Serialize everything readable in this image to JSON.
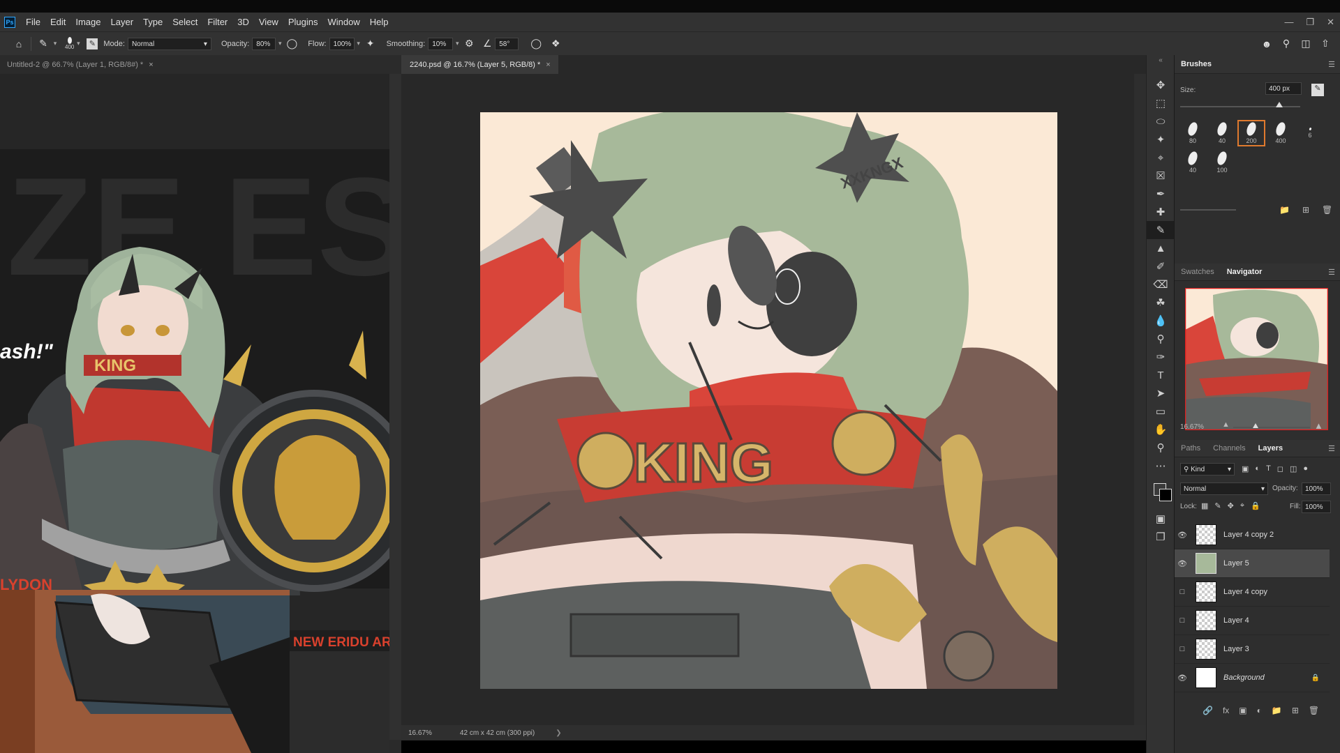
{
  "app": {
    "logo_text": "Ps",
    "menu": [
      "File",
      "Edit",
      "Image",
      "Layer",
      "Type",
      "Select",
      "Filter",
      "3D",
      "View",
      "Plugins",
      "Window",
      "Help"
    ],
    "window_controls": [
      "minimize",
      "restore",
      "close"
    ]
  },
  "options_bar": {
    "brush_size_value": "400",
    "mode_label": "Mode:",
    "mode_value": "Normal",
    "opacity_label": "Opacity:",
    "opacity_value": "80%",
    "flow_label": "Flow:",
    "flow_value": "100%",
    "smoothing_label": "Smoothing:",
    "smoothing_value": "10%",
    "angle_value": "58°"
  },
  "tabs": {
    "left": "Untitled-2 @ 66.7% (Layer 1, RGB/8#) *",
    "active": "2240.psd @ 16.7% (Layer 5, RGB/8) *"
  },
  "status": {
    "zoom": "16.67%",
    "doc_size": "42 cm x 42 cm (300 ppi)"
  },
  "reference_image": {
    "caption_left": "ash!\"",
    "caption_bottom_left": "LYDON",
    "caption_bottom_right": "NEW ERIDU AR",
    "belt_text": "KING"
  },
  "artwork": {
    "banner_text": "KING",
    "hair_text": "XXKNGX"
  },
  "brushes_panel": {
    "title": "Brushes",
    "size_label": "Size:",
    "size_value": "400 px",
    "presets": [
      "80",
      "40",
      "200",
      "400",
      "6",
      "40",
      "100"
    ],
    "selected_preset": "200"
  },
  "navigator_panel": {
    "tabs": [
      "Swatches",
      "Navigator"
    ],
    "active_tab": "Navigator",
    "zoom": "16.67%"
  },
  "layers_panel": {
    "tabs": [
      "Paths",
      "Channels",
      "Layers"
    ],
    "active_tab": "Layers",
    "filter_kind": "Kind",
    "blend_mode": "Normal",
    "opacity_label": "Opacity:",
    "opacity_value": "100%",
    "lock_label": "Lock:",
    "fill_label": "Fill:",
    "fill_value": "100%",
    "layers": [
      {
        "name": "Layer 4 copy 2",
        "visible": true
      },
      {
        "name": "Layer 5",
        "visible": true,
        "selected": true
      },
      {
        "name": "Layer 4 copy",
        "visible": false
      },
      {
        "name": "Layer 4",
        "visible": false
      },
      {
        "name": "Layer 3",
        "visible": false
      },
      {
        "name": "Background",
        "visible": true,
        "locked": true
      }
    ]
  },
  "colors": {
    "accent_selected": "#e07a2e",
    "canvas_bg": "#fbe9d6",
    "hair_green": "#a7b99a",
    "red": "#d9453a"
  }
}
